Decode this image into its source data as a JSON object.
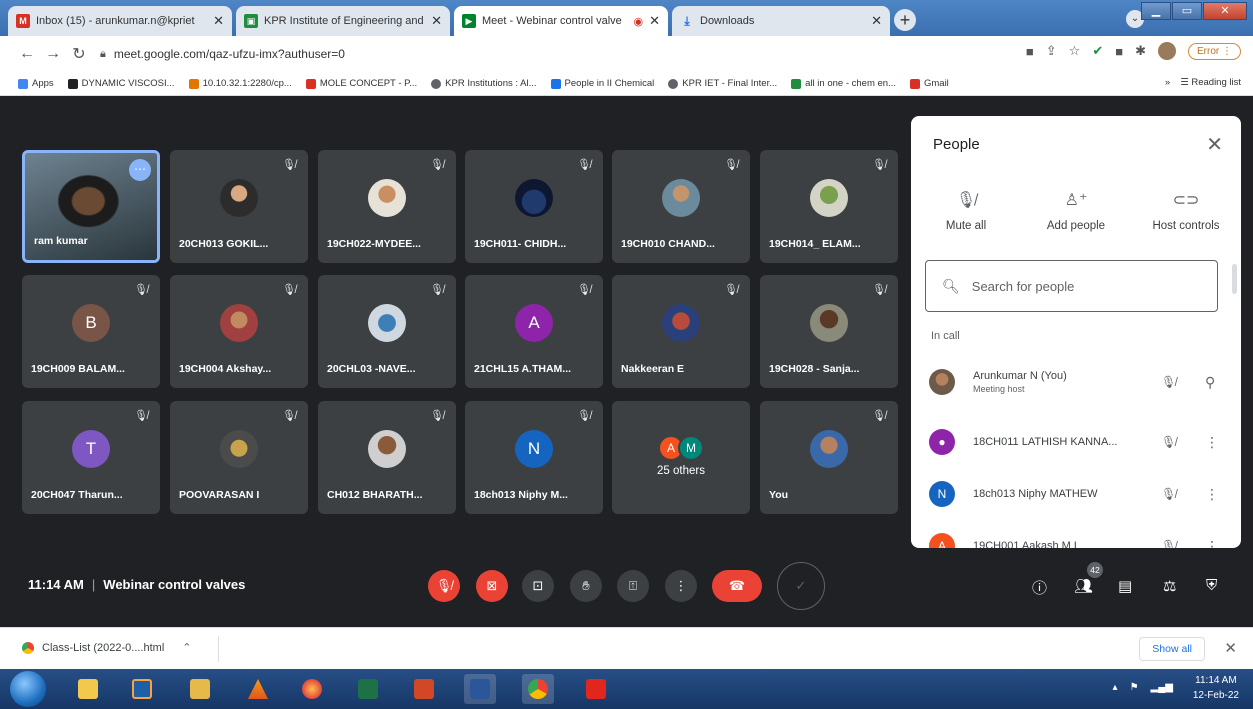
{
  "browser": {
    "tabs": [
      {
        "title": "Inbox (15) - arunkumar.n@kpriet",
        "favicon": "gmail-icon",
        "color": "#d93025",
        "active": false
      },
      {
        "title": "KPR Institute of Engineering and",
        "favicon": "classroom-icon",
        "color": "#1e8e3e",
        "active": false
      },
      {
        "title": "Meet - Webinar control valve",
        "favicon": "meet-icon",
        "color": "#00832d",
        "active": true
      },
      {
        "title": "Downloads",
        "favicon": "download-icon",
        "color": "#1a73e8",
        "active": false
      }
    ],
    "url": "meet.google.com/qaz-ufzu-imx?authuser=0",
    "error_label": "Error",
    "bookmarks": [
      {
        "label": "Apps",
        "color": "#4285f4"
      },
      {
        "label": "DYNAMIC VISCOSI...",
        "color": "#202124"
      },
      {
        "label": "10.10.32.1:2280/cp...",
        "color": "#e37400"
      },
      {
        "label": "MOLE CONCEPT - P...",
        "color": "#d93025"
      },
      {
        "label": "KPR Institutions : Al...",
        "color": "#5f6368"
      },
      {
        "label": "People in II Chemical",
        "color": "#1a73e8"
      },
      {
        "label": "KPR IET - Final Inter...",
        "color": "#5f6368"
      },
      {
        "label": "all in one - chem en...",
        "color": "#1e8e3e"
      },
      {
        "label": "Gmail",
        "color": "#d93025"
      }
    ],
    "bookmarks_more": "»",
    "reading_list": "Reading list"
  },
  "meet": {
    "tiles": [
      {
        "name": "ram kumar",
        "kind": "self"
      },
      {
        "name": "20CH013 GOKIL...",
        "kind": "photo",
        "style": "photo"
      },
      {
        "name": "19CH022-MYDEE...",
        "kind": "photo",
        "style": "photo2"
      },
      {
        "name": "19CH011- CHIDH...",
        "kind": "photo",
        "style": "photo3"
      },
      {
        "name": "19CH010 CHAND...",
        "kind": "photo",
        "style": "photo4"
      },
      {
        "name": "19CH014_ ELAM...",
        "kind": "photo",
        "style": "photo5"
      },
      {
        "name": "19CH009 BALAM...",
        "kind": "letter",
        "letter": "B",
        "color": "#795548"
      },
      {
        "name": "19CH004 Akshay...",
        "kind": "photo",
        "style": "photo6"
      },
      {
        "name": "20CHL03 -NAVE...",
        "kind": "photo",
        "style": "photo7"
      },
      {
        "name": "21CHL15 A.THAM...",
        "kind": "letter",
        "letter": "A",
        "color": "#8e24aa"
      },
      {
        "name": "Nakkeeran E",
        "kind": "photo",
        "style": "photo8"
      },
      {
        "name": "19CH028 - Sanja...",
        "kind": "photo",
        "style": "photo9"
      },
      {
        "name": "20CH047 Tharun...",
        "kind": "letter",
        "letter": "T",
        "color": "#7e57c2"
      },
      {
        "name": "POOVARASAN I",
        "kind": "photo",
        "style": "photo10"
      },
      {
        "name": "CH012 BHARATH...",
        "kind": "photo",
        "style": "photo11"
      },
      {
        "name": "18ch013 Niphy M...",
        "kind": "letter",
        "letter": "N",
        "color": "#1565c0"
      },
      {
        "name": "25 others",
        "kind": "others",
        "letters": [
          "A",
          "M"
        ],
        "colors": [
          "#f4511e",
          "#00897b"
        ]
      },
      {
        "name": "You",
        "kind": "photo",
        "style": "photo12"
      }
    ],
    "time": "11:14 AM",
    "meeting_title": "Webinar control valves",
    "people_count": "42"
  },
  "panel": {
    "title": "People",
    "actions": [
      {
        "label": "Mute all",
        "icon": "mic-off-icon"
      },
      {
        "label": "Add people",
        "icon": "add-person-icon"
      },
      {
        "label": "Host controls",
        "icon": "toggle-icon"
      }
    ],
    "search_placeholder": "Search for people",
    "section": "In call",
    "people": [
      {
        "name": "Arunkumar N (You)",
        "sub": "Meeting host",
        "avatar": "photo",
        "color": "#6d5a48",
        "trailing": "pin"
      },
      {
        "name": "18CH011 LATHISH KANNA...",
        "sub": "",
        "avatar": "person",
        "color": "#8e24aa",
        "trailing": "more"
      },
      {
        "name": "18ch013 Niphy MATHEW",
        "sub": "",
        "avatar": "N",
        "color": "#1565c0",
        "trailing": "more"
      },
      {
        "name": "19CH001 Aakash M L",
        "sub": "",
        "avatar": "A",
        "color": "#f4511e",
        "trailing": "more"
      }
    ]
  },
  "downloads": {
    "file": "Class-List (2022-0....html",
    "show_all": "Show all"
  },
  "taskbar": {
    "time": "11:14 AM",
    "date": "12-Feb-22"
  }
}
